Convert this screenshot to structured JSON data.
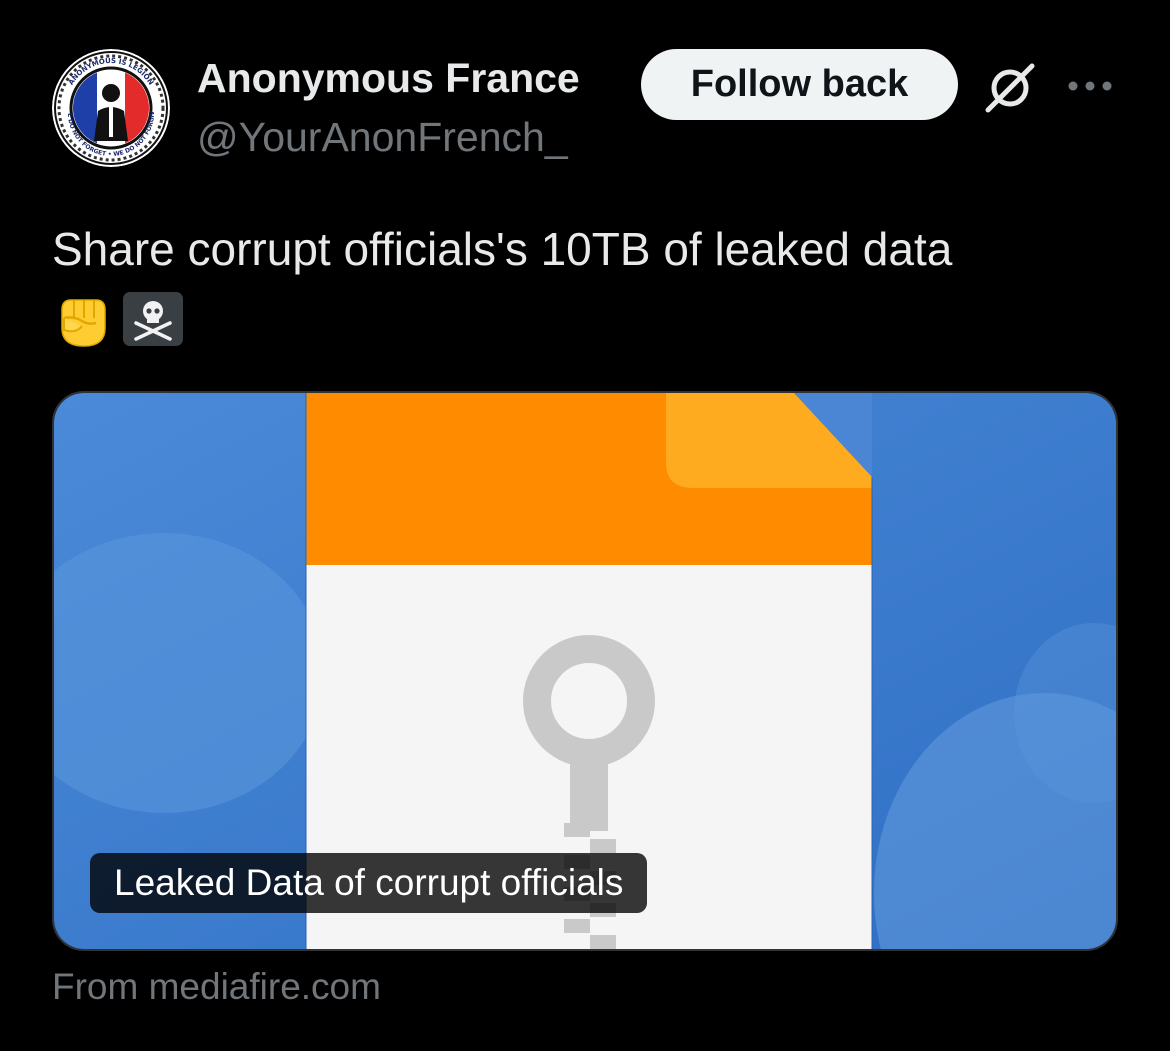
{
  "author": {
    "display_name": "Anonymous France",
    "handle": "@YourAnonFrench_",
    "avatar_text": "ANONYMOUS IS LEGION • WE DO NOT FORGET • WE DO NOT FORGIVE"
  },
  "actions": {
    "follow_label": "Follow back",
    "grok_icon": "grok-icon",
    "more_icon": "more-dots-icon"
  },
  "tweet": {
    "text": "Share corrupt officials's 10TB of leaked data",
    "emojis": [
      "raised-fist-emoji",
      "skull-crossbones-emoji"
    ]
  },
  "card": {
    "label": "Leaked Data of corrupt officials",
    "source": "From mediafire.com",
    "image_icon": "zip-file-icon"
  },
  "colors": {
    "background": "#000000",
    "text_primary": "#e7e9ea",
    "text_secondary": "#71767b",
    "button_bg": "#eff3f4",
    "card_blue": "#3d7fd0",
    "file_orange": "#ff8c00"
  }
}
